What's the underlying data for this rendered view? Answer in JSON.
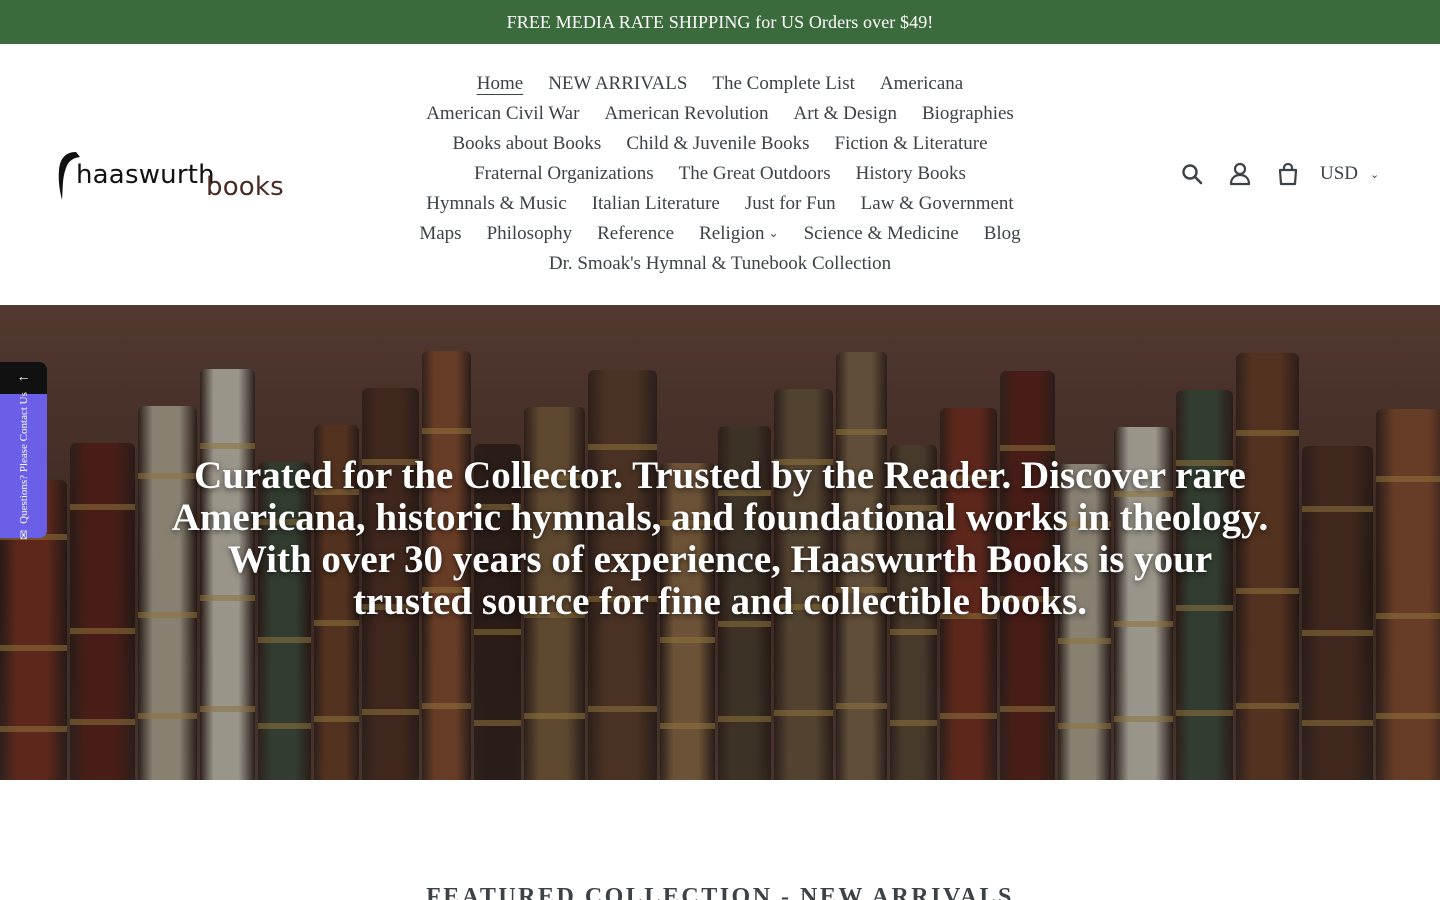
{
  "announcement": {
    "text": "FREE MEDIA RATE SHIPPING for US Orders over $49!"
  },
  "logo": {
    "word_main": "haaswurth",
    "word_secondary": "books"
  },
  "nav": {
    "rows": [
      [
        {
          "label": "Home",
          "active": true
        },
        {
          "label": "NEW ARRIVALS"
        },
        {
          "label": "The Complete List"
        },
        {
          "label": "Americana"
        }
      ],
      [
        {
          "label": "American Civil War"
        },
        {
          "label": "American Revolution"
        },
        {
          "label": "Art & Design"
        },
        {
          "label": "Biographies"
        }
      ],
      [
        {
          "label": "Books about Books"
        },
        {
          "label": "Child & Juvenile Books"
        },
        {
          "label": "Fiction & Literature"
        }
      ],
      [
        {
          "label": "Fraternal Organizations"
        },
        {
          "label": "The Great Outdoors"
        },
        {
          "label": "History Books"
        }
      ],
      [
        {
          "label": "Hymnals & Music"
        },
        {
          "label": "Italian Literature"
        },
        {
          "label": "Just for Fun"
        },
        {
          "label": "Law & Government"
        }
      ],
      [
        {
          "label": "Maps"
        },
        {
          "label": "Philosophy"
        },
        {
          "label": "Reference"
        },
        {
          "label": "Religion",
          "dropdown": true
        },
        {
          "label": "Science & Medicine"
        },
        {
          "label": "Blog"
        }
      ],
      [
        {
          "label": "Dr. Smoak's Hymnal & Tunebook Collection"
        }
      ]
    ]
  },
  "header_icons": {
    "search": "search-icon",
    "account": "account-icon",
    "cart": "cart-icon"
  },
  "currency": {
    "selected": "USD"
  },
  "hero": {
    "text": "Curated for the Collector. Trusted by the Reader. Discover rare Americana, historic hymnals, and foundational works in theology. With over 30 years of experience, Haaswurth Books is your trusted source for fine and collectible books."
  },
  "contact_tab": {
    "arrow": "←",
    "label": "Questions? Please Contact Us",
    "icon": "mail-icon"
  },
  "featured": {
    "heading": "FEATURED COLLECTION - NEW ARRIVALS"
  },
  "colors": {
    "announcement_bg": "#3b6b3c",
    "contact_tab_bg": "#6a5fe6",
    "text": "#3d4246"
  }
}
